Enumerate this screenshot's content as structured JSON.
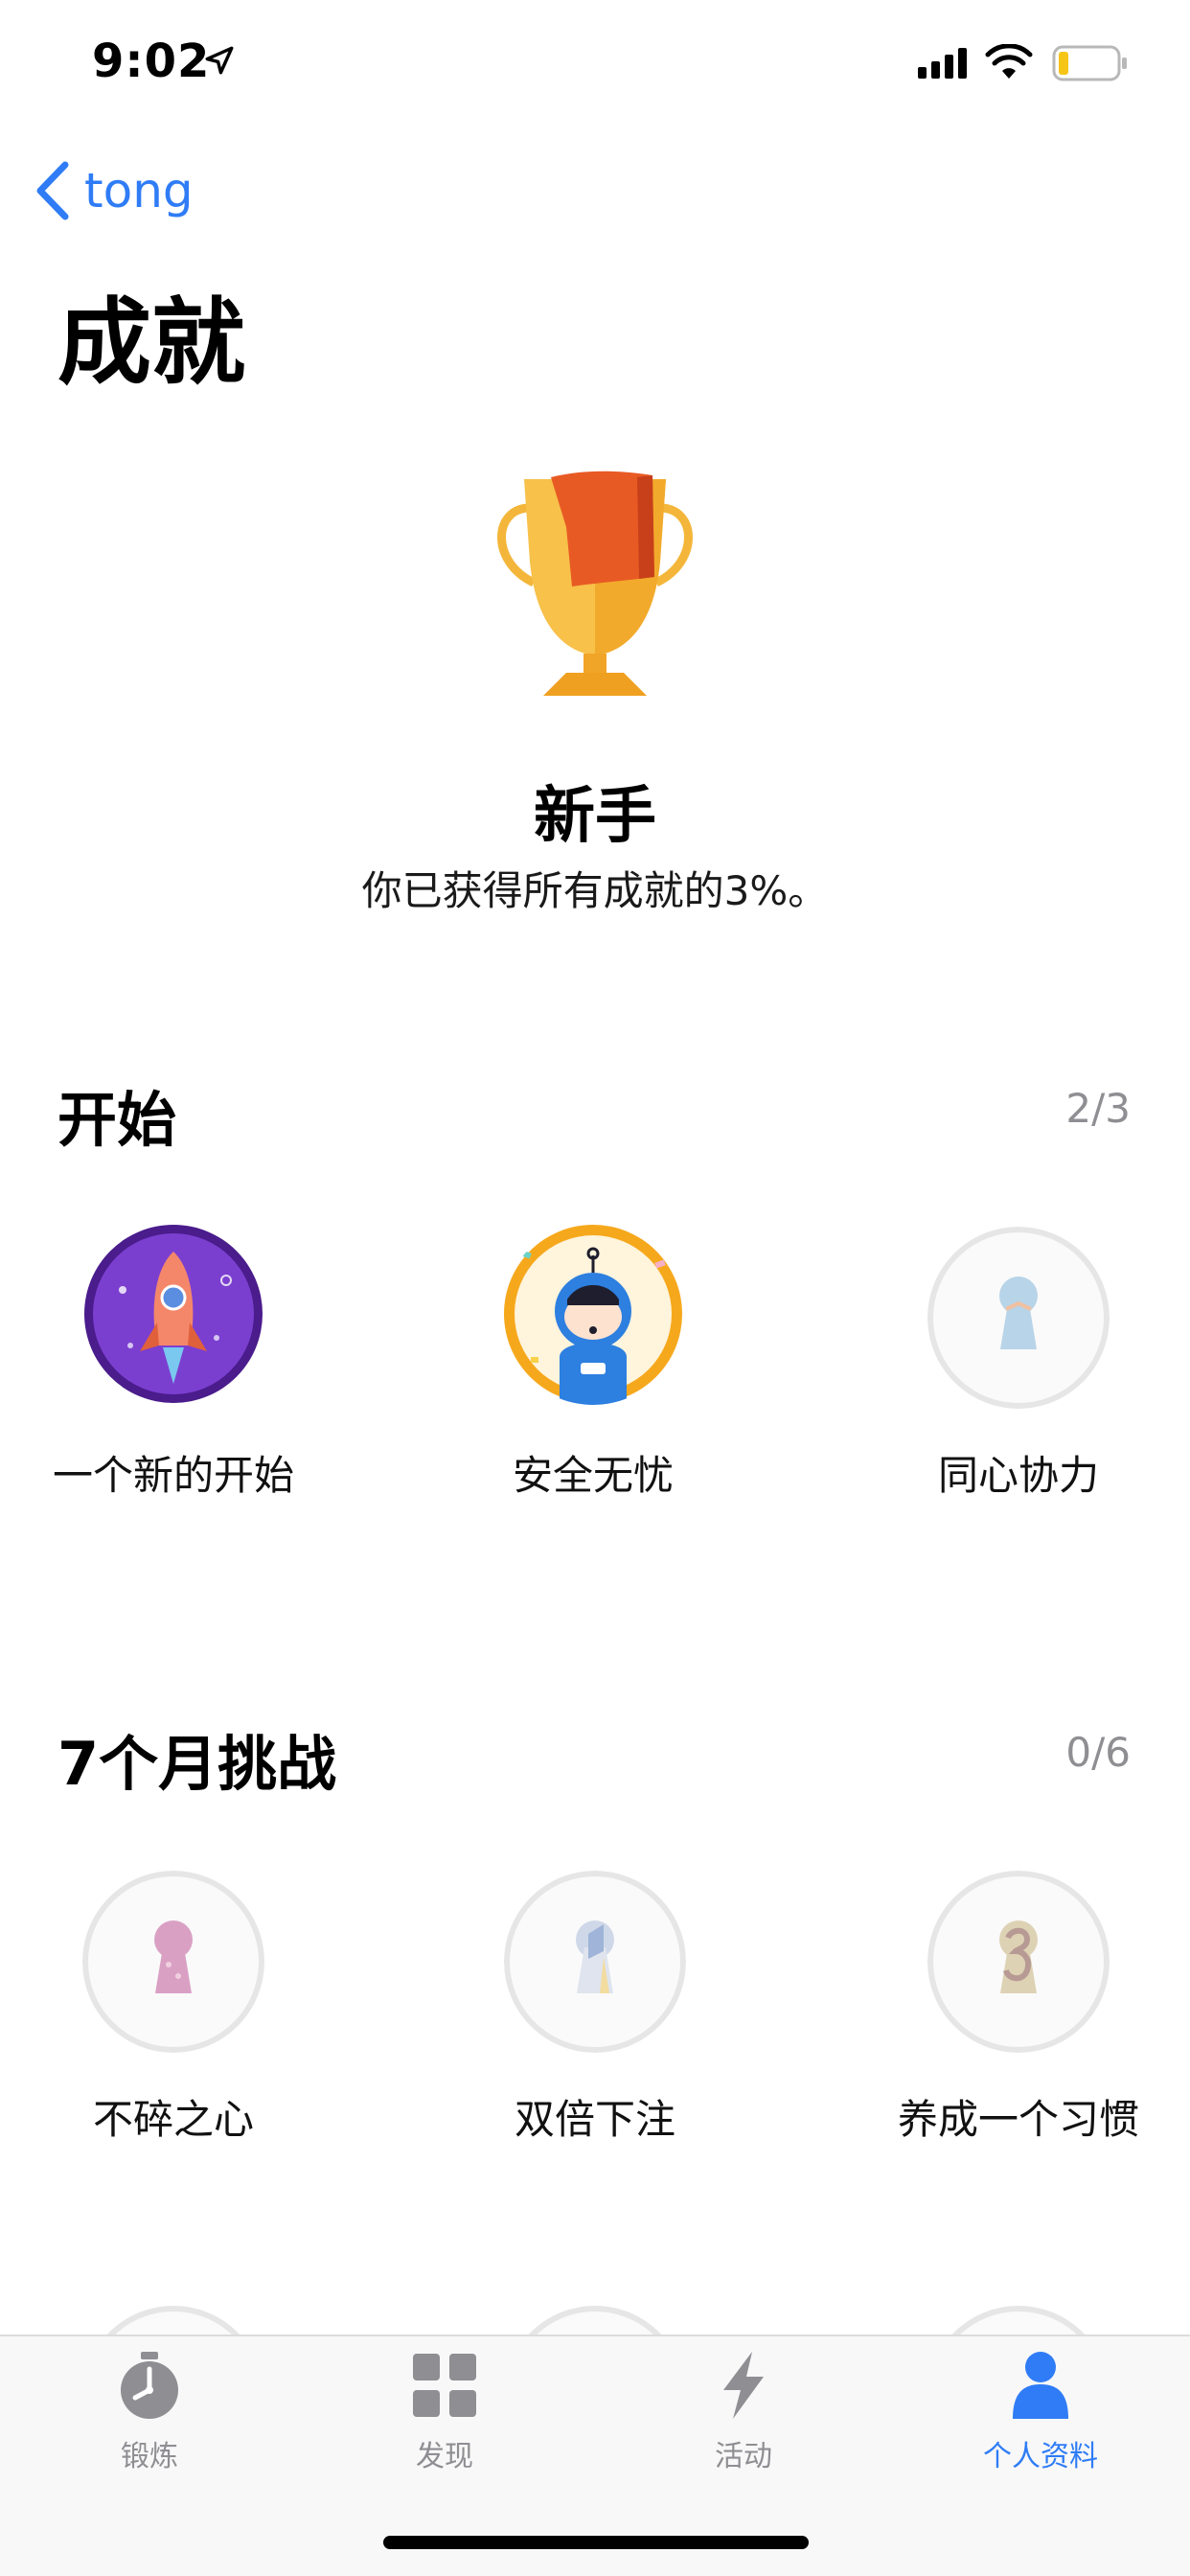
{
  "status": {
    "time": "9:02"
  },
  "nav": {
    "back_label": "tong"
  },
  "page": {
    "title": "成就"
  },
  "level": {
    "name": "新手",
    "description": "你已获得所有成就的3%。"
  },
  "sections": [
    {
      "title": "开始",
      "count": "2/3",
      "badges": [
        {
          "label": "一个新的开始",
          "icon": "rocket-badge-icon",
          "earned": true
        },
        {
          "label": "安全无忧",
          "icon": "astronaut-badge-icon",
          "earned": true
        },
        {
          "label": "同心协力",
          "icon": "keyhole-badge-icon",
          "earned": false
        }
      ]
    },
    {
      "title": "7个月挑战",
      "count": "0/6",
      "badges": [
        {
          "label": "不碎之心",
          "icon": "keyhole-badge-icon",
          "earned": false
        },
        {
          "label": "双倍下注",
          "icon": "keyhole-badge-icon",
          "earned": false
        },
        {
          "label": "养成一个习惯",
          "icon": "keyhole-badge-icon",
          "earned": false
        }
      ]
    }
  ],
  "tabs": [
    {
      "label": "锻炼",
      "icon": "stopwatch-icon",
      "active": false
    },
    {
      "label": "发现",
      "icon": "grid-icon",
      "active": false
    },
    {
      "label": "活动",
      "icon": "lightning-icon",
      "active": false
    },
    {
      "label": "个人资料",
      "icon": "person-icon",
      "active": true
    }
  ],
  "colors": {
    "accent": "#2f7cf6",
    "inactive": "#8e8e93",
    "battery_low": "#f5c518"
  }
}
